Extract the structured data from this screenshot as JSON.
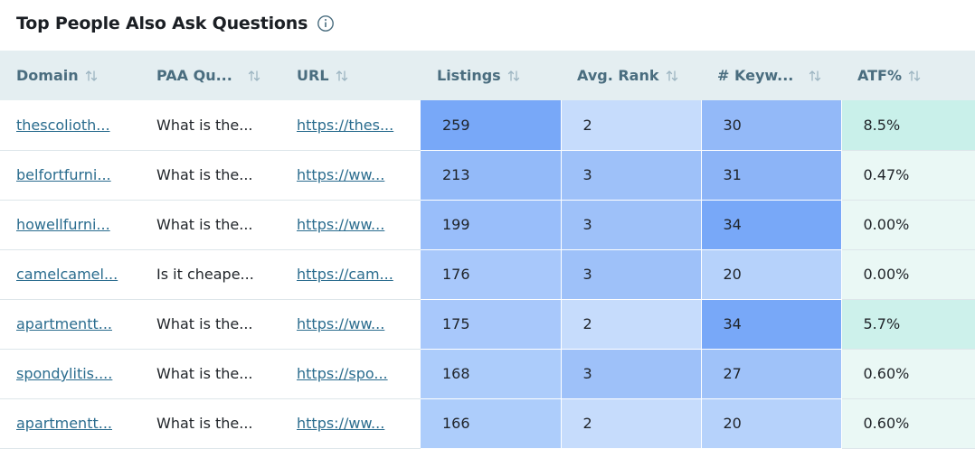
{
  "widget": {
    "title": "Top People Also Ask Questions",
    "info_icon": "info-circle-icon"
  },
  "columns": [
    {
      "key": "domain",
      "label": "Domain"
    },
    {
      "key": "paa",
      "label": "PAA Qu..."
    },
    {
      "key": "url",
      "label": "URL"
    },
    {
      "key": "listings",
      "label": "Listings"
    },
    {
      "key": "rank",
      "label": "Avg. Rank"
    },
    {
      "key": "keywords",
      "label": "# Keyw..."
    },
    {
      "key": "atf",
      "label": "ATF%"
    }
  ],
  "sort_icon": "sort-arrows-icon",
  "rows": [
    {
      "domain": "thescolioth...",
      "paa": "What is the...",
      "url": "https://thes...",
      "listings": "259",
      "rank": "2",
      "keywords": "30",
      "atf": "8.5%"
    },
    {
      "domain": "belfortfurni...",
      "paa": "What is the...",
      "url": "https://ww...",
      "listings": "213",
      "rank": "3",
      "keywords": "31",
      "atf": "0.47%"
    },
    {
      "domain": "howellfurni...",
      "paa": "What is the...",
      "url": "https://ww...",
      "listings": "199",
      "rank": "3",
      "keywords": "34",
      "atf": "0.00%"
    },
    {
      "domain": "camelcamel...",
      "paa": "Is it cheape...",
      "url": "https://cam...",
      "listings": "176",
      "rank": "3",
      "keywords": "20",
      "atf": "0.00%"
    },
    {
      "domain": "apartmentt...",
      "paa": "What is the...",
      "url": "https://ww...",
      "listings": "175",
      "rank": "2",
      "keywords": "34",
      "atf": "5.7%"
    },
    {
      "domain": "spondylitis....",
      "paa": "What is the...",
      "url": "https://spo...",
      "listings": "168",
      "rank": "3",
      "keywords": "27",
      "atf": "0.60%"
    },
    {
      "domain": "apartmentt...",
      "paa": "What is the...",
      "url": "https://ww...",
      "listings": "166",
      "rank": "2",
      "keywords": "20",
      "atf": "0.60%"
    }
  ],
  "heat_colors": {
    "listings": [
      "#78a8f8",
      "#93baf9",
      "#99befa",
      "#a8c8fb",
      "#a8c8fb",
      "#acccfb",
      "#adcdfb"
    ],
    "rank": [
      "#c6dcfc",
      "#9ec1f9",
      "#9ec1f9",
      "#9ec1f9",
      "#c6dcfc",
      "#9ec1f9",
      "#c6dcfc"
    ],
    "keywords": [
      "#93b9f8",
      "#8cb4f7",
      "#78a8f8",
      "#b6d2fb",
      "#78a8f8",
      "#9fc2f9",
      "#b6d2fb"
    ],
    "atf": [
      "#c9f0ea",
      "#eaf8f5",
      "#eaf8f5",
      "#eaf8f5",
      "#cdf1eb",
      "#eaf8f5",
      "#eaf8f5"
    ]
  },
  "colors": {
    "header_bg": "#e4eef1",
    "header_text": "#4a6d7f",
    "link": "#2a6c8e"
  }
}
